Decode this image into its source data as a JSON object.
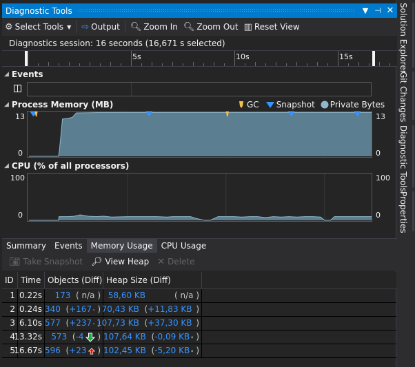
{
  "window": {
    "title": "Diagnostic Tools",
    "menu_icon": "dropdown-icon",
    "pin_icon": "pin-icon",
    "close_icon": "close-icon"
  },
  "toolbar": {
    "select_tools": "Select Tools",
    "output": "Output",
    "zoom_in": "Zoom In",
    "zoom_out": "Zoom Out",
    "reset_view": "Reset View"
  },
  "session": {
    "text": "Diagnostics session: 16 seconds (16,671 s selected)"
  },
  "ruler": {
    "labels": [
      "5s",
      "10s",
      "15s"
    ]
  },
  "events": {
    "title": "Events",
    "pause_icon": "pause-icon"
  },
  "memory": {
    "title": "Process Memory (MB)",
    "legend": {
      "gc": "GC",
      "snapshot": "Snapshot",
      "private_bytes": "Private Bytes"
    },
    "y_max": "13",
    "y_min": "0",
    "colors": {
      "fill": "#5b7f91",
      "line": "#8fb8cc",
      "gc": "#f5c04a",
      "snapshot": "#3794ff"
    }
  },
  "cpu": {
    "title": "CPU (% of all processors)",
    "y_max": "100",
    "y_min": "0"
  },
  "chart_data": [
    {
      "type": "area",
      "title": "Process Memory (MB)",
      "x_unit": "s",
      "xlim": [
        0,
        16.67
      ],
      "ylim": [
        0,
        13
      ],
      "series": [
        {
          "name": "Private Bytes",
          "x": [
            0,
            1.5,
            1.55,
            1.7,
            2.0,
            2.2,
            2.4,
            3.5,
            6.0,
            10.0,
            13.3,
            16.67
          ],
          "y": [
            0,
            0,
            2.0,
            11.0,
            11.2,
            11.5,
            12.8,
            12.9,
            12.9,
            12.9,
            12.9,
            12.9
          ]
        }
      ],
      "markers": {
        "gc": [
          0.3,
          10.0
        ],
        "snapshot": [
          0.22,
          0.24,
          6.1,
          13.32,
          16.67
        ]
      }
    },
    {
      "type": "area",
      "title": "CPU (% of all processors)",
      "x_unit": "s",
      "xlim": [
        0,
        16.67
      ],
      "ylim": [
        0,
        100
      ],
      "series": [
        {
          "name": "CPU",
          "x": [
            0,
            1.5,
            1.52,
            2.0,
            2.3,
            2.6,
            3.0,
            3.4,
            3.8,
            4.2,
            5.0,
            6.0,
            6.5,
            7.0,
            7.3,
            7.6,
            8.2,
            8.5,
            8.9,
            9.2,
            9.6,
            10.0,
            10.4,
            10.8,
            11.2,
            11.6,
            12.0,
            12.4,
            12.8,
            13.2,
            13.6,
            14.0,
            14.4,
            14.8,
            15.0,
            15.3,
            15.5,
            16.0,
            16.67
          ],
          "y": [
            0,
            0,
            8,
            8,
            9,
            12,
            9,
            8,
            9,
            7,
            8,
            8,
            8,
            7,
            8,
            8,
            8,
            4,
            0,
            0,
            8,
            8,
            8,
            7,
            8,
            8,
            6,
            8,
            7,
            8,
            7,
            8,
            8,
            7,
            0,
            0,
            8,
            8,
            8
          ]
        }
      ]
    }
  ],
  "tabs": [
    {
      "label": "Summary",
      "active": false
    },
    {
      "label": "Events",
      "active": false
    },
    {
      "label": "Memory Usage",
      "active": true
    },
    {
      "label": "CPU Usage",
      "active": false
    }
  ],
  "memory_toolbar": {
    "take_snapshot": "Take Snapshot",
    "view_heap": "View Heap",
    "delete": "Delete"
  },
  "table": {
    "headers": [
      "ID",
      "Time",
      "Objects (Diff)",
      "Heap Size (Diff)"
    ],
    "rows": [
      {
        "id": "1",
        "time": "0.22s",
        "objects": "173",
        "objects_diff": "n/a",
        "objects_dir": "none",
        "heap": "58,60 KB",
        "heap_diff": "n/a",
        "heap_dir": "none"
      },
      {
        "id": "2",
        "time": "0.24s",
        "objects": "340",
        "objects_diff": "+167",
        "objects_dir": "up",
        "heap": "70,43 KB",
        "heap_diff": "+11,83 KB",
        "heap_dir": "up"
      },
      {
        "id": "3",
        "time": "6.10s",
        "objects": "577",
        "objects_diff": "+237",
        "objects_dir": "up",
        "heap": "107,73 KB",
        "heap_diff": "+37,30 KB",
        "heap_dir": "up"
      },
      {
        "id": "4",
        "time": "13.32s",
        "objects": "573",
        "objects_diff": "-4",
        "objects_dir": "down",
        "heap": "107,64 KB",
        "heap_diff": "-0,09 KB",
        "heap_dir": "down"
      },
      {
        "id": "5",
        "time": "16.67s",
        "objects": "596",
        "objects_diff": "+23",
        "objects_dir": "up",
        "heap": "102,45 KB",
        "heap_diff": "-5,20 KB",
        "heap_dir": "down"
      }
    ]
  },
  "side_tabs": [
    "Solution Explorer",
    "Git Changes",
    "Diagnostic Tools",
    "Properties"
  ]
}
